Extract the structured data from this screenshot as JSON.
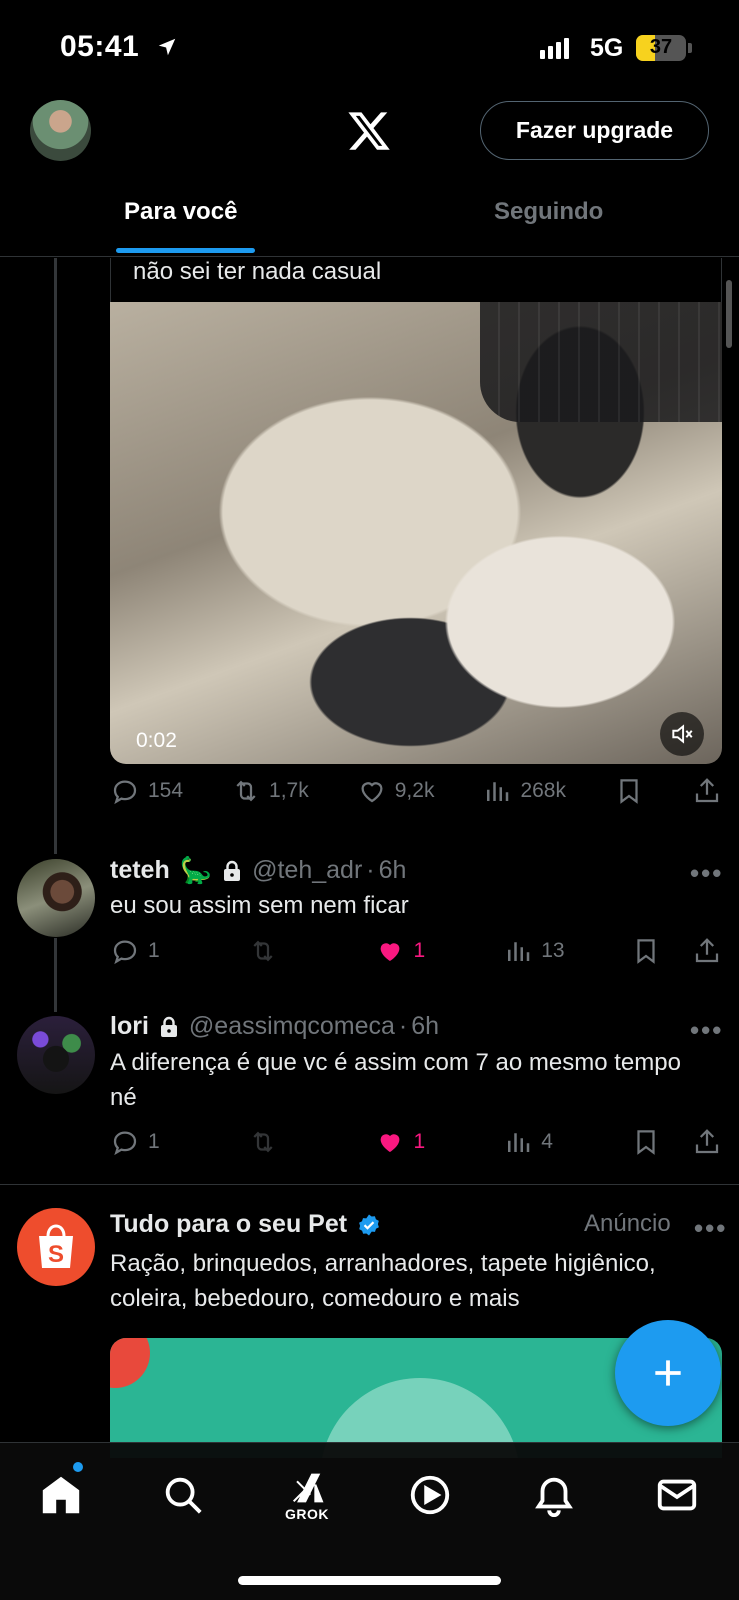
{
  "status_bar": {
    "time": "05:41",
    "network": "5G",
    "battery_level": "37",
    "battery_fraction": 0.37
  },
  "header": {
    "upgrade_label": "Fazer upgrade"
  },
  "tabs": [
    {
      "label": "Para você",
      "active": true
    },
    {
      "label": "Seguindo",
      "active": false
    }
  ],
  "main_post": {
    "quote_text": "não sei ter nada casual",
    "video_time": "0:02",
    "stats": {
      "replies": "154",
      "reposts": "1,7k",
      "likes": "9,2k",
      "views": "268k"
    }
  },
  "replies": [
    {
      "name": "teteh",
      "emoji": "🦕",
      "handle": "@teh_adr",
      "time": "6h",
      "text": "eu sou assim sem nem ficar",
      "stats": {
        "replies": "1",
        "likes": "1",
        "views": "13"
      }
    },
    {
      "name": "lori",
      "handle": "@eassimqcomeca",
      "time": "6h",
      "text": "A diferença é que vc é assim com 7 ao mesmo tempo né",
      "stats": {
        "replies": "1",
        "likes": "1",
        "views": "4"
      }
    }
  ],
  "ad": {
    "name": "Tudo para o seu Pet",
    "label": "Anúncio",
    "text": "Ração, brinquedos, arranhadores, tapete higiênico, coleira, bebedouro, comedouro e mais",
    "logo_letter": "S"
  },
  "nav": {
    "grok_label": "GROK"
  },
  "separator": "·",
  "more": "•••",
  "colors": {
    "accent": "#1d9bf0",
    "like": "#f91880",
    "muted": "#71767b",
    "ad_brand": "#ee4d2d"
  }
}
